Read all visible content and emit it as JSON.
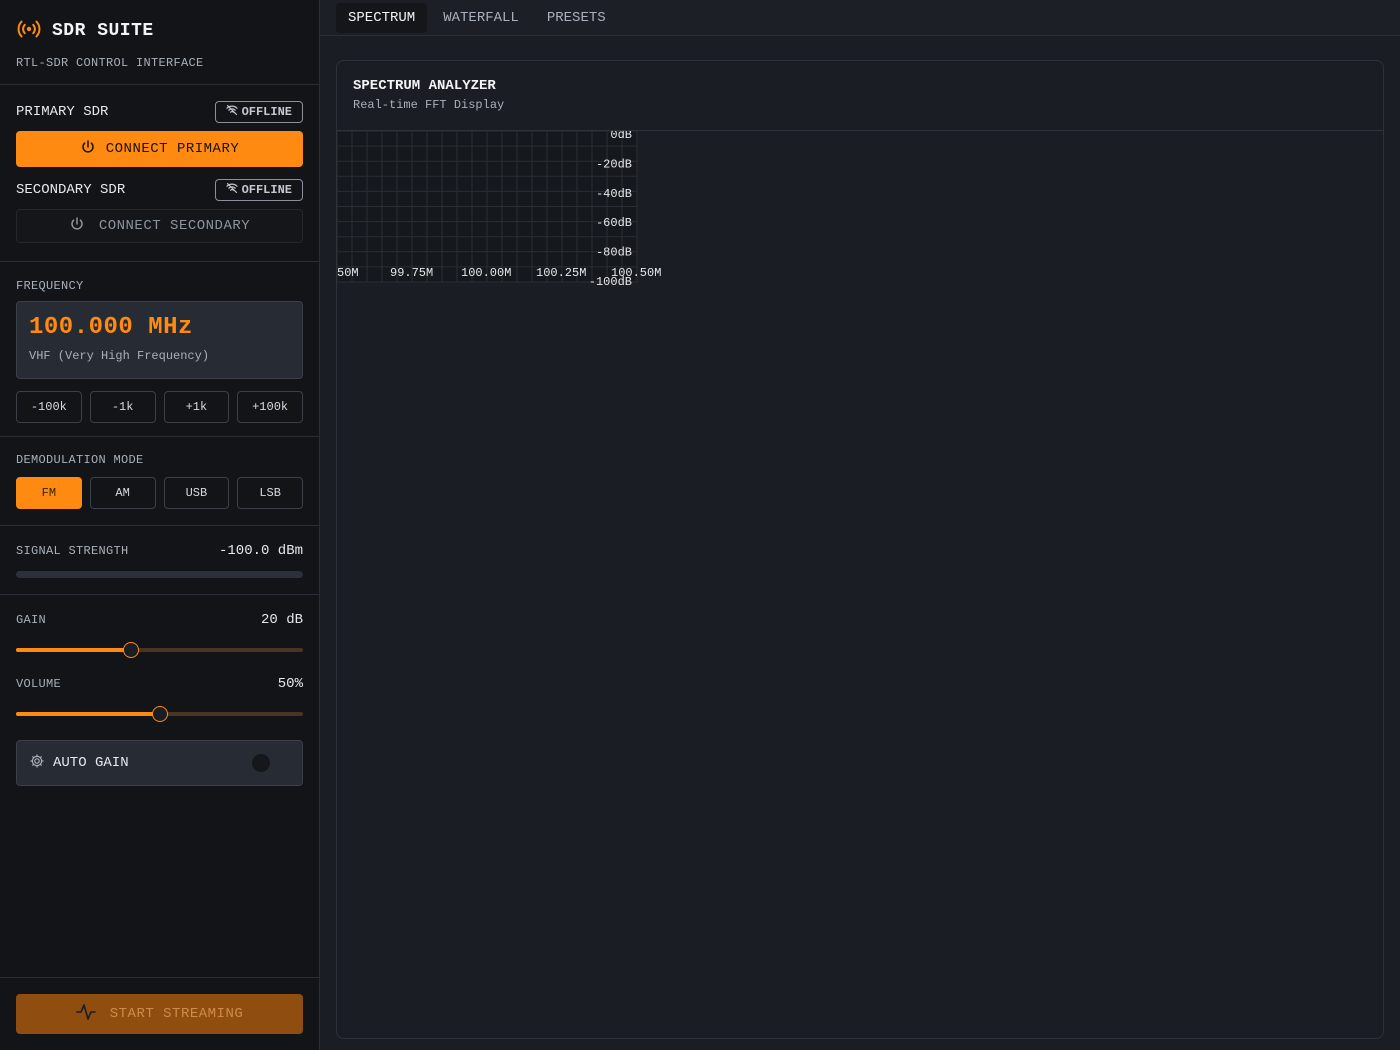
{
  "app": {
    "title": "SDR SUITE",
    "subtitle": "RTL-SDR CONTROL INTERFACE",
    "accent": "#ff8a12",
    "logo_icon": "radio-broadcast-icon"
  },
  "sdr": {
    "primary": {
      "name": "PRIMARY SDR",
      "status": "OFFLINE",
      "button": "CONNECT PRIMARY"
    },
    "secondary": {
      "name": "SECONDARY SDR",
      "status": "OFFLINE",
      "button": "CONNECT SECONDARY"
    }
  },
  "frequency": {
    "label": "FREQUENCY",
    "value": "100.000 MHz",
    "band": "VHF (Very High Frequency)",
    "steps": [
      "-100k",
      "-1k",
      "+1k",
      "+100k"
    ]
  },
  "demod": {
    "label": "DEMODULATION MODE",
    "modes": [
      "FM",
      "AM",
      "USB",
      "LSB"
    ],
    "selected": "FM"
  },
  "signal": {
    "label": "SIGNAL STRENGTH",
    "value": "-100.0 dBm",
    "level": 0
  },
  "gain": {
    "label": "GAIN",
    "value": "20 dB",
    "level": 0.4
  },
  "volume": {
    "label": "VOLUME",
    "value": "50%",
    "level": 0.5
  },
  "auto_gain": {
    "label": "AUTO GAIN",
    "enabled": false
  },
  "stream": {
    "button": "START STREAMING"
  },
  "tabs": [
    "SPECTRUM",
    "WATERFALL",
    "PRESETS"
  ],
  "active_tab": "SPECTRUM",
  "spectrum": {
    "title": "SPECTRUM ANALYZER",
    "subtitle": "Real-time FFT Display"
  },
  "chart_data": {
    "type": "line",
    "x_tick_labels": [
      "50M",
      "99.75M",
      "100.00M",
      "100.25M",
      "100.50M"
    ],
    "y_tick_labels": [
      "0dB",
      "-20dB",
      "-40dB",
      "-60dB",
      "-80dB",
      "-100dB"
    ],
    "ylim": [
      -100,
      0
    ],
    "grid": true,
    "series": []
  }
}
